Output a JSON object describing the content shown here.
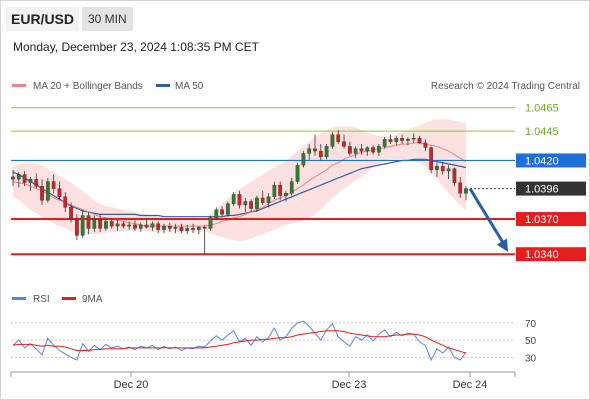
{
  "header": {
    "symbol": "EUR/USD",
    "timeframe": "30 MIN",
    "datetime": "Monday, December 23, 2024 1:08:35 PM CET"
  },
  "legend": {
    "ma20": "MA 20 + Bollinger Bands",
    "ma50": "MA 50",
    "source": "Research © 2024 Trading Central"
  },
  "colors": {
    "bull": "#2e7d32",
    "bear": "#c62828",
    "ma20": "#f08080",
    "ma50": "#2f5e9e",
    "band_fill": "#fcd9d9",
    "resistance_green": "#8bc34a",
    "pivot_blue": "#1e6fd9",
    "support_red": "#e41e1e",
    "current_price": "#333333",
    "forecast_arrow": "#2a5fa8",
    "rsi": "#5b86d6",
    "rsi_ma": "#e41e1e"
  },
  "chart_data": [
    {
      "type": "candlestick",
      "x_axis": {
        "tick_labels": [
          "Dec 20",
          "Dec 23",
          "Dec 24"
        ]
      },
      "y_axis": {
        "ylim": [
          1.0318,
          1.0475
        ],
        "scale": "linear",
        "grid": false
      },
      "levels": [
        {
          "value": "1.0465",
          "type": "resistance",
          "color": "#8bc34a",
          "style": "text"
        },
        {
          "value": "1.0445",
          "type": "resistance",
          "color": "#8bc34a",
          "style": "text"
        },
        {
          "value": "1.0420",
          "type": "pivot",
          "color": "#1e6fd9",
          "style": "box"
        },
        {
          "value": "1.0396",
          "type": "current",
          "color": "#333333",
          "style": "box-dark"
        },
        {
          "value": "1.0370",
          "type": "support",
          "color": "#e41e1e",
          "style": "box"
        },
        {
          "value": "1.0340",
          "type": "support",
          "color": "#e41e1e",
          "style": "box"
        }
      ],
      "forecast": {
        "from_price": 1.0396,
        "to_price": 1.0342,
        "direction": "down"
      },
      "candles": [
        [
          1.0406,
          1.0412,
          1.0398,
          1.0404
        ],
        [
          1.0404,
          1.041,
          1.0397,
          1.0408
        ],
        [
          1.0408,
          1.0411,
          1.0398,
          1.0401
        ],
        [
          1.0401,
          1.0406,
          1.0394,
          1.0404
        ],
        [
          1.0404,
          1.0409,
          1.0396,
          1.0398
        ],
        [
          1.0398,
          1.0404,
          1.0382,
          1.0386
        ],
        [
          1.0386,
          1.0405,
          1.0384,
          1.0402
        ],
        [
          1.0402,
          1.0408,
          1.0392,
          1.0396
        ],
        [
          1.0396,
          1.0402,
          1.0386,
          1.0389
        ],
        [
          1.0389,
          1.0393,
          1.0376,
          1.038
        ],
        [
          1.038,
          1.0384,
          1.0367,
          1.037
        ],
        [
          1.037,
          1.0374,
          1.0352,
          1.0356
        ],
        [
          1.0356,
          1.0378,
          1.0354,
          1.0373
        ],
        [
          1.0373,
          1.0376,
          1.0357,
          1.0362
        ],
        [
          1.0362,
          1.0373,
          1.0359,
          1.037
        ],
        [
          1.037,
          1.0374,
          1.0359,
          1.0362
        ],
        [
          1.0362,
          1.0371,
          1.036,
          1.0368
        ],
        [
          1.0368,
          1.037,
          1.0362,
          1.0364
        ],
        [
          1.0364,
          1.0369,
          1.036,
          1.0366
        ],
        [
          1.0366,
          1.0368,
          1.0362,
          1.0364
        ],
        [
          1.0364,
          1.0368,
          1.0361,
          1.0365
        ],
        [
          1.0365,
          1.0369,
          1.036,
          1.0362
        ],
        [
          1.0362,
          1.0367,
          1.0359,
          1.0365
        ],
        [
          1.0365,
          1.0371,
          1.0362,
          1.0363
        ],
        [
          1.0363,
          1.0368,
          1.036,
          1.0366
        ],
        [
          1.0366,
          1.0368,
          1.0358,
          1.0361
        ],
        [
          1.0361,
          1.0366,
          1.0358,
          1.0364
        ],
        [
          1.0364,
          1.0367,
          1.0359,
          1.0362
        ],
        [
          1.0362,
          1.0366,
          1.0358,
          1.0363
        ],
        [
          1.0363,
          1.0366,
          1.0358,
          1.036
        ],
        [
          1.036,
          1.0365,
          1.0357,
          1.0362
        ],
        [
          1.0362,
          1.0366,
          1.0358,
          1.0361
        ],
        [
          1.0361,
          1.0364,
          1.0357,
          1.0363
        ],
        [
          1.0363,
          1.0365,
          1.034,
          1.0362
        ],
        [
          1.0362,
          1.0373,
          1.036,
          1.0371
        ],
        [
          1.0371,
          1.038,
          1.0369,
          1.0378
        ],
        [
          1.0378,
          1.0381,
          1.0372,
          1.0374
        ],
        [
          1.0374,
          1.0385,
          1.0372,
          1.0383
        ],
        [
          1.0383,
          1.0393,
          1.0381,
          1.0391
        ],
        [
          1.0391,
          1.0394,
          1.0379,
          1.0382
        ],
        [
          1.0382,
          1.0388,
          1.0376,
          1.0385
        ],
        [
          1.0385,
          1.0387,
          1.0376,
          1.0379
        ],
        [
          1.0379,
          1.039,
          1.0376,
          1.0388
        ],
        [
          1.0388,
          1.0394,
          1.0382,
          1.0384
        ],
        [
          1.0384,
          1.0392,
          1.038,
          1.0389
        ],
        [
          1.0389,
          1.0402,
          1.0387,
          1.0399
        ],
        [
          1.0399,
          1.0402,
          1.0386,
          1.039
        ],
        [
          1.039,
          1.0394,
          1.0385,
          1.0392
        ],
        [
          1.0392,
          1.0405,
          1.039,
          1.0402
        ],
        [
          1.0402,
          1.0418,
          1.04,
          1.0416
        ],
        [
          1.0416,
          1.0428,
          1.0414,
          1.0426
        ],
        [
          1.0426,
          1.0434,
          1.042,
          1.043
        ],
        [
          1.043,
          1.0442,
          1.0424,
          1.0428
        ],
        [
          1.0428,
          1.0434,
          1.042,
          1.0423
        ],
        [
          1.0423,
          1.0434,
          1.0421,
          1.0432
        ],
        [
          1.0432,
          1.0444,
          1.043,
          1.0442
        ],
        [
          1.0442,
          1.0446,
          1.0434,
          1.0436
        ],
        [
          1.0436,
          1.0442,
          1.043,
          1.0432
        ],
        [
          1.0432,
          1.0436,
          1.0424,
          1.0426
        ],
        [
          1.0426,
          1.0432,
          1.0422,
          1.043
        ],
        [
          1.043,
          1.0434,
          1.0425,
          1.0428
        ],
        [
          1.0428,
          1.0432,
          1.0424,
          1.0431
        ],
        [
          1.0431,
          1.0433,
          1.0425,
          1.0427
        ],
        [
          1.0427,
          1.0434,
          1.0424,
          1.0432
        ],
        [
          1.0432,
          1.044,
          1.043,
          1.0438
        ],
        [
          1.0438,
          1.0442,
          1.0434,
          1.0436
        ],
        [
          1.0436,
          1.0441,
          1.0433,
          1.0439
        ],
        [
          1.0439,
          1.0442,
          1.0434,
          1.0437
        ],
        [
          1.0437,
          1.044,
          1.0433,
          1.0438
        ],
        [
          1.0438,
          1.0443,
          1.0435,
          1.0439
        ],
        [
          1.0439,
          1.0441,
          1.0434,
          1.0435
        ],
        [
          1.0435,
          1.0438,
          1.0428,
          1.0431
        ],
        [
          1.0431,
          1.0432,
          1.0409,
          1.0412
        ],
        [
          1.0412,
          1.0418,
          1.0406,
          1.0415
        ],
        [
          1.0415,
          1.0419,
          1.0408,
          1.0411
        ],
        [
          1.0411,
          1.0416,
          1.0404,
          1.0413
        ],
        [
          1.0413,
          1.0414,
          1.0398,
          1.0401
        ],
        [
          1.0401,
          1.0406,
          1.0388,
          1.0392
        ],
        [
          1.0392,
          1.0398,
          1.0386,
          1.0396
        ]
      ],
      "ma20": [
        1.0402,
        1.0401,
        1.04,
        1.0398,
        1.0396,
        1.0394,
        1.0391,
        1.0388,
        1.0386,
        1.0384,
        1.0382,
        1.038,
        1.0378,
        1.0376,
        1.0374,
        1.0372,
        1.0371,
        1.037,
        1.0369,
        1.0368,
        1.0367,
        1.0366,
        1.0365,
        1.0364,
        1.0364,
        1.0364,
        1.0364,
        1.0364,
        1.0364,
        1.0364,
        1.0364,
        1.0364,
        1.0364,
        1.0364,
        1.0365,
        1.0366,
        1.0368,
        1.0369,
        1.0371,
        1.0372,
        1.0374,
        1.0376,
        1.0378,
        1.038,
        1.0383,
        1.0386,
        1.0388,
        1.039,
        1.0393,
        1.0396,
        1.0399,
        1.0403,
        1.0406,
        1.0409,
        1.0412,
        1.0416,
        1.0418,
        1.0421,
        1.0423,
        1.0425,
        1.0427,
        1.0428,
        1.0429,
        1.043,
        1.0431,
        1.0432,
        1.0433,
        1.0434,
        1.0434,
        1.0435,
        1.0435,
        1.0434,
        1.0433,
        1.0432,
        1.043,
        1.0428,
        1.0425,
        1.0422,
        1.0419
      ],
      "ma50": [
        1.041,
        1.0408,
        1.0405,
        1.0402,
        1.0399,
        1.0396,
        1.0393,
        1.039,
        1.0387,
        1.0384,
        1.0381,
        1.0379,
        1.0377,
        1.0376,
        1.0375,
        1.0374,
        1.0374,
        1.0374,
        1.0374,
        1.0374,
        1.0374,
        1.0374,
        1.0373,
        1.0373,
        1.0373,
        1.0373,
        1.0372,
        1.0372,
        1.0372,
        1.0372,
        1.0372,
        1.0372,
        1.0372,
        1.0372,
        1.0372,
        1.0372,
        1.0372,
        1.0373,
        1.0373,
        1.0374,
        1.0375,
        1.0376,
        1.0377,
        1.0379,
        1.0381,
        1.0383,
        1.0385,
        1.0387,
        1.0389,
        1.0391,
        1.0393,
        1.0395,
        1.0397,
        1.0399,
        1.0401,
        1.0403,
        1.0405,
        1.0407,
        1.0409,
        1.0411,
        1.0413,
        1.0414,
        1.0415,
        1.0416,
        1.0417,
        1.0418,
        1.0419,
        1.042,
        1.042,
        1.0421,
        1.0421,
        1.0421,
        1.042,
        1.0419,
        1.0418,
        1.0417,
        1.0416,
        1.0415,
        1.0414
      ],
      "bb_upper": [
        1.0415,
        1.0417,
        1.0418,
        1.0418,
        1.0417,
        1.0416,
        1.0413,
        1.041,
        1.0407,
        1.0404,
        1.0401,
        1.0398,
        1.0394,
        1.039,
        1.0386,
        1.0383,
        1.0381,
        1.038,
        1.0379,
        1.0378,
        1.0377,
        1.0376,
        1.0375,
        1.0374,
        1.0373,
        1.0372,
        1.0371,
        1.037,
        1.0369,
        1.0369,
        1.0369,
        1.0369,
        1.0369,
        1.0369,
        1.0373,
        1.0378,
        1.0383,
        1.0387,
        1.0392,
        1.0396,
        1.0399,
        1.0402,
        1.0405,
        1.0408,
        1.0411,
        1.0414,
        1.0417,
        1.042,
        1.0424,
        1.0428,
        1.0432,
        1.0436,
        1.044,
        1.0443,
        1.0446,
        1.0448,
        1.0449,
        1.0449,
        1.0449,
        1.0448,
        1.0446,
        1.0444,
        1.0442,
        1.0441,
        1.044,
        1.0441,
        1.0442,
        1.0444,
        1.0446,
        1.0448,
        1.045,
        1.0452,
        1.0454,
        1.0455,
        1.0455,
        1.0455,
        1.0454,
        1.0453,
        1.0452
      ],
      "bb_lower": [
        1.0389,
        1.0386,
        1.0382,
        1.0378,
        1.0375,
        1.0372,
        1.0369,
        1.0366,
        1.0364,
        1.0362,
        1.036,
        1.0358,
        1.0357,
        1.0357,
        1.0357,
        1.0357,
        1.0358,
        1.0359,
        1.0359,
        1.036,
        1.036,
        1.036,
        1.036,
        1.036,
        1.0359,
        1.0359,
        1.0359,
        1.0359,
        1.0359,
        1.0359,
        1.0359,
        1.0359,
        1.0359,
        1.0359,
        1.0358,
        1.0356,
        1.0355,
        1.0353,
        1.0352,
        1.0351,
        1.0352,
        1.0353,
        1.0355,
        1.0357,
        1.0359,
        1.0361,
        1.0363,
        1.0365,
        1.0366,
        1.0367,
        1.0369,
        1.0371,
        1.0374,
        1.0378,
        1.0383,
        1.0388,
        1.0392,
        1.0396,
        1.0399,
        1.0403,
        1.0406,
        1.041,
        1.0414,
        1.0417,
        1.042,
        1.0421,
        1.0421,
        1.0421,
        1.042,
        1.0419,
        1.0418,
        1.0415,
        1.041,
        1.0404,
        1.0398,
        1.0392,
        1.0387,
        1.0382,
        1.0378
      ]
    },
    {
      "type": "line",
      "indicator": "RSI",
      "ylim": [
        20,
        78
      ],
      "tick_labels": [
        "70",
        "50",
        "30"
      ],
      "legend": [
        "RSI",
        "9MA"
      ],
      "rsi": [
        44,
        50,
        41,
        46,
        40,
        33,
        52,
        44,
        38,
        34,
        30,
        27,
        46,
        37,
        44,
        39,
        45,
        41,
        43,
        40,
        42,
        39,
        43,
        41,
        44,
        39,
        43,
        40,
        42,
        38,
        41,
        40,
        43,
        42,
        49,
        55,
        50,
        56,
        61,
        48,
        52,
        44,
        54,
        48,
        53,
        64,
        50,
        54,
        64,
        70,
        72,
        66,
        58,
        50,
        62,
        69,
        54,
        48,
        43,
        54,
        50,
        56,
        49,
        57,
        62,
        54,
        59,
        55,
        58,
        57,
        48,
        44,
        27,
        40,
        35,
        42,
        30,
        27,
        36
      ],
      "rsi_ma": [
        44,
        45,
        45,
        45,
        44,
        43,
        44,
        43,
        43,
        42,
        40,
        38,
        38,
        38,
        39,
        39,
        40,
        40,
        40,
        40,
        41,
        41,
        41,
        41,
        41,
        41,
        41,
        41,
        41,
        41,
        41,
        41,
        41,
        41,
        42,
        43,
        44,
        45,
        47,
        48,
        49,
        50,
        50,
        51,
        51,
        52,
        53,
        53,
        54,
        56,
        57,
        58,
        59,
        60,
        61,
        61,
        61,
        60,
        58,
        57,
        56,
        55,
        54,
        54,
        54,
        55,
        56,
        56,
        57,
        57,
        56,
        54,
        50,
        47,
        44,
        41,
        39,
        37,
        35
      ]
    }
  ]
}
